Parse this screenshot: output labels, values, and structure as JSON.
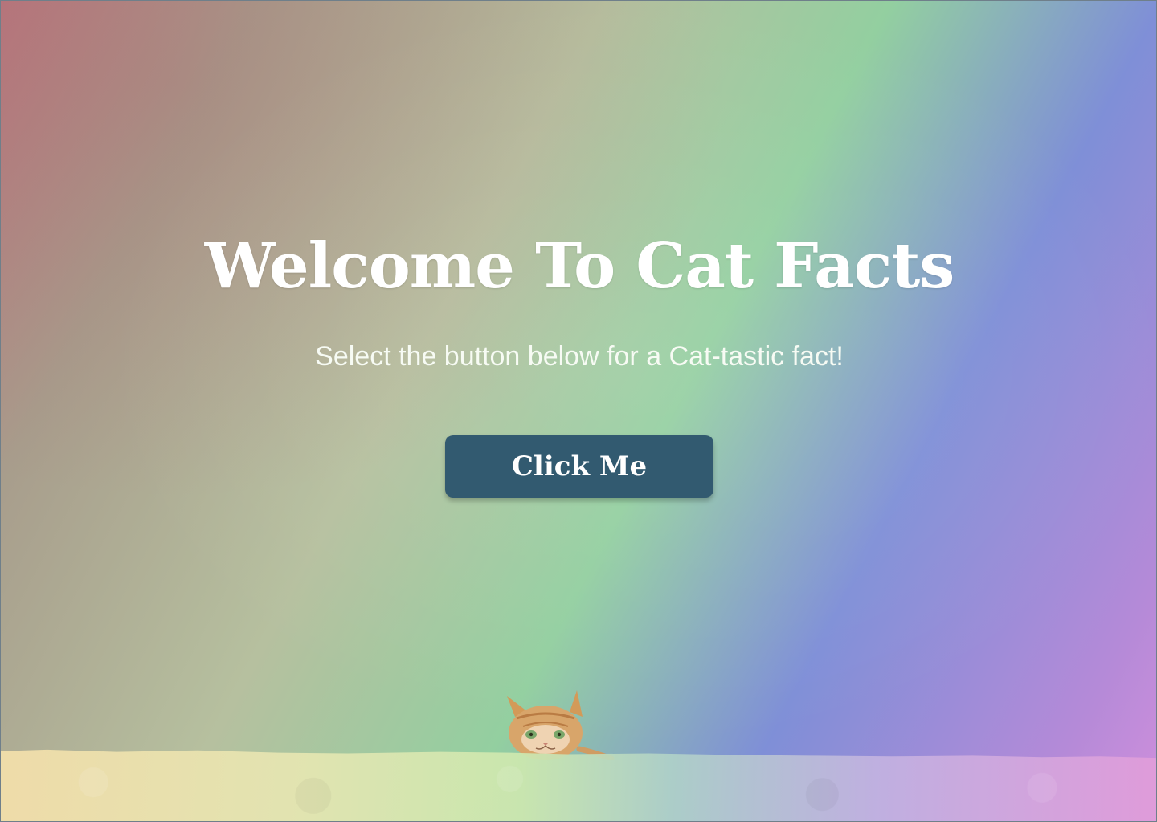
{
  "hero": {
    "title": "Welcome To Cat Facts",
    "subtitle": "Select the button below for a Cat-tastic fact!",
    "button_label": "Click Me"
  },
  "colors": {
    "button": "#325a70",
    "text": "#ffffff"
  }
}
